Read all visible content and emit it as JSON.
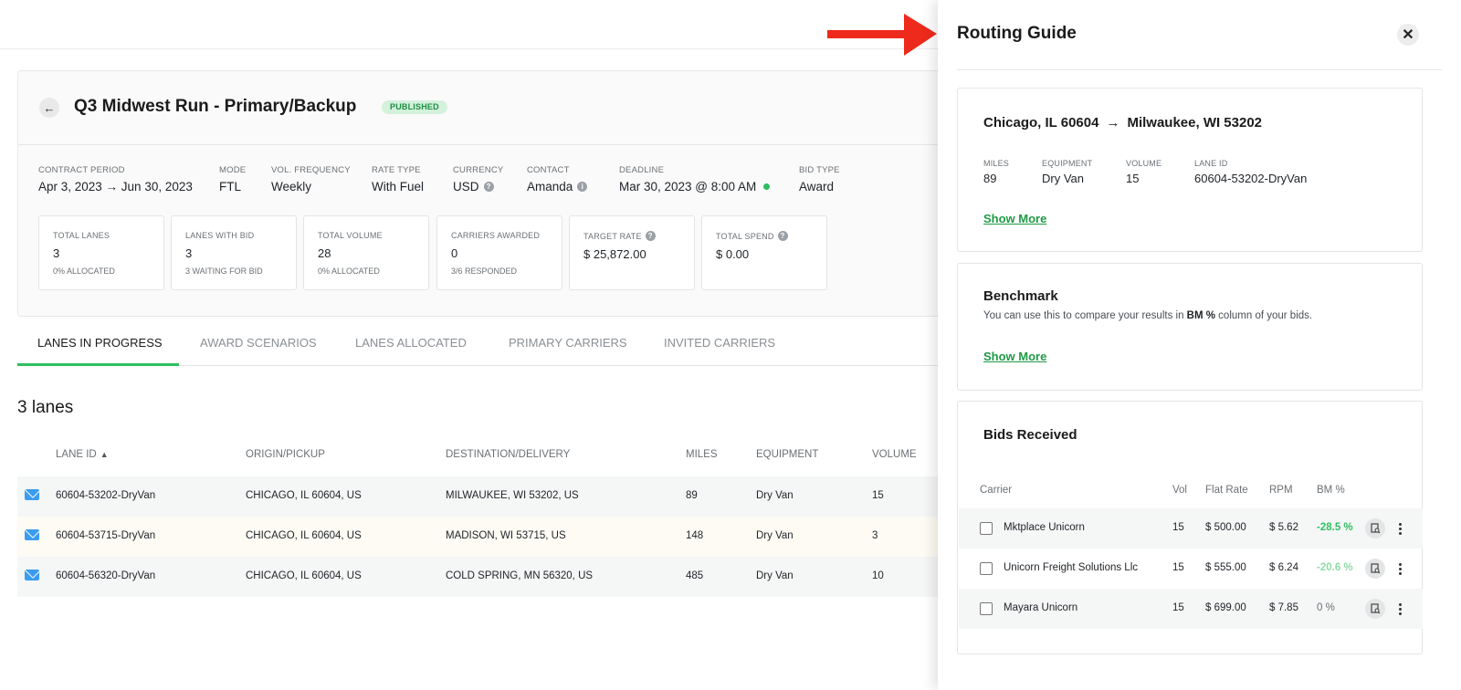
{
  "header": {
    "bid_title": "Q3 Midwest Run - Primary/Backup",
    "status": "PUBLISHED"
  },
  "contract_info": [
    {
      "label": "CONTRACT PERIOD",
      "value": "Apr 3, 2023 → Jun 30, 2023"
    },
    {
      "label": "MODE",
      "value": "FTL"
    },
    {
      "label": "VOL. FREQUENCY",
      "value": "Weekly"
    },
    {
      "label": "RATE TYPE",
      "value": "With Fuel"
    },
    {
      "label": "CURRENCY",
      "value": "USD"
    },
    {
      "label": "CONTACT",
      "value": "Amanda"
    },
    {
      "label": "DEADLINE",
      "value": "Mar 30, 2023 @ 8:00 AM"
    },
    {
      "label": "BID TYPE",
      "value": "Award"
    }
  ],
  "stats": [
    {
      "label": "TOTAL LANES",
      "value": "3",
      "sub": "0% ALLOCATED"
    },
    {
      "label": "LANES WITH BID",
      "value": "3",
      "sub": "3 WAITING FOR BID"
    },
    {
      "label": "TOTAL VOLUME",
      "value": "28",
      "sub": "0% ALLOCATED"
    },
    {
      "label": "CARRIERS AWARDED",
      "value": "0",
      "sub": "3/6 RESPONDED"
    },
    {
      "label": "TARGET RATE",
      "value": "$ 25,872.00",
      "sub": ""
    },
    {
      "label": "TOTAL SPEND",
      "value": "$ 0.00",
      "sub": ""
    }
  ],
  "tabs": [
    "LANES IN PROGRESS",
    "AWARD SCENARIOS",
    "LANES ALLOCATED",
    "PRIMARY CARRIERS",
    "INVITED CARRIERS"
  ],
  "lanes_count": "3 lanes",
  "lanes_table": {
    "columns": [
      "LANE ID",
      "ORIGIN/PICKUP",
      "DESTINATION/DELIVERY",
      "MILES",
      "EQUIPMENT",
      "VOLUME"
    ],
    "rows": [
      [
        "60604-53202-DryVan",
        "CHICAGO, IL 60604, US",
        "MILWAUKEE, WI 53202, US",
        "89",
        "Dry Van",
        "15"
      ],
      [
        "60604-53715-DryVan",
        "CHICAGO, IL 60604, US",
        "MADISON, WI 53715, US",
        "148",
        "Dry Van",
        "3"
      ],
      [
        "60604-56320-DryVan",
        "CHICAGO, IL 60604, US",
        "COLD SPRING, MN 56320, US",
        "485",
        "Dry Van",
        "10"
      ]
    ],
    "row_colors": [
      "#f5f6f6",
      "#fdfbf3",
      "#f5f6f6"
    ]
  },
  "drawer": {
    "title": "Routing Guide",
    "close_label": "✕",
    "lane": {
      "origin": "Chicago, IL 60604",
      "arrow": "→",
      "destination": "Milwaukee, WI 53202",
      "details": [
        {
          "label": "MILES",
          "value": "89"
        },
        {
          "label": "EQUIPMENT",
          "value": "Dry Van"
        },
        {
          "label": "VOLUME",
          "value": "15"
        },
        {
          "label": "LANE ID",
          "value": "60604-53202-DryVan"
        }
      ],
      "show_more": "Show More"
    },
    "benchmark": {
      "title": "Benchmark",
      "desc_before": "You can use this to compare your results in ",
      "desc_bold": "BM %",
      "desc_after": " column of your bids.",
      "show_more": "Show More"
    },
    "bids": {
      "title": "Bids Received",
      "columns": [
        "Carrier",
        "Vol",
        "Flat Rate",
        "RPM",
        "BM %"
      ],
      "rows": [
        {
          "carrier": "Mktplace Unicorn",
          "vol": "15",
          "flat_rate": "$ 500.00",
          "rpm": "$ 5.62",
          "bm": "-28.5 %"
        },
        {
          "carrier": "Unicorn Freight Solutions Llc",
          "vol": "15",
          "flat_rate": "$ 555.00",
          "rpm": "$ 6.24",
          "bm": "-20.6 %"
        },
        {
          "carrier": "Mayara Unicorn",
          "vol": "15",
          "flat_rate": "$ 699.00",
          "rpm": "$ 7.85",
          "bm": "0 %"
        }
      ]
    }
  },
  "colors": {
    "accent_green": "#2fbf60",
    "link_green": "#1f9a46",
    "annotation_red": "#ee2a1c",
    "mail_blue": "#3b9cf0"
  }
}
